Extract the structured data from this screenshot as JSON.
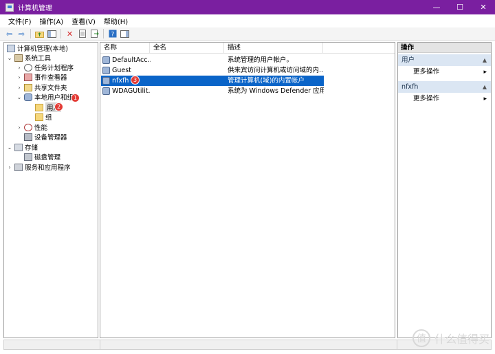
{
  "window": {
    "title": "计算机管理",
    "minimize": "—",
    "maximize": "☐",
    "close": "✕"
  },
  "menu": [
    "文件(F)",
    "操作(A)",
    "查看(V)",
    "帮助(H)"
  ],
  "tree": {
    "root": "计算机管理(本地)",
    "system_tools": "系统工具",
    "task_scheduler": "任务计划程序",
    "event_viewer": "事件查看器",
    "shared_folders": "共享文件夹",
    "local_users": "本地用户和组",
    "users": "用户",
    "groups": "组",
    "performance": "性能",
    "device_manager": "设备管理器",
    "storage": "存储",
    "disk_management": "磁盘管理",
    "services": "服务和应用程序"
  },
  "badges": {
    "b1": "1",
    "b2": "2",
    "b3": "3"
  },
  "list": {
    "columns": [
      "名称",
      "全名",
      "描述"
    ],
    "rows": [
      {
        "name": "DefaultAcc...",
        "fullname": "",
        "desc": "系统管理的用户帐户。"
      },
      {
        "name": "Guest",
        "fullname": "",
        "desc": "供来宾访问计算机或访问域的内..."
      },
      {
        "name": "nfxfh",
        "fullname": "",
        "desc": "管理计算机(域)的内置帐户"
      },
      {
        "name": "WDAGUtilit...",
        "fullname": "",
        "desc": "系统为 Windows Defender 应用..."
      }
    ]
  },
  "actions": {
    "title": "操作",
    "section1": "用户",
    "more1": "更多操作",
    "section2": "nfxfh",
    "more2": "更多操作"
  },
  "watermark": {
    "logo": "值",
    "text": "什么值得买"
  },
  "colors": {
    "titlebar": "#7a1fa0",
    "selection": "#0a64c8",
    "badge": "#e33b35"
  }
}
